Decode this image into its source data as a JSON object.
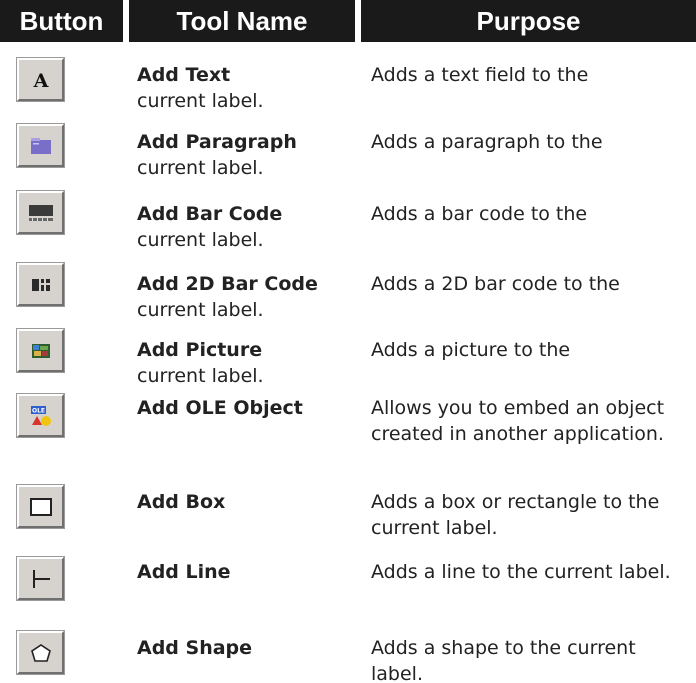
{
  "header": {
    "button": "Button",
    "tool_name": "Tool Name",
    "purpose": "Purpose"
  },
  "rows": [
    {
      "icon": "text-a-icon",
      "tool": "Add Text",
      "purpose": "Adds a text field to the",
      "continuation": "current label."
    },
    {
      "icon": "paragraph-icon",
      "tool": "Add Paragraph",
      "purpose": "Adds a paragraph to the",
      "continuation": "current label."
    },
    {
      "icon": "barcode-icon",
      "tool": "Add Bar Code",
      "purpose": "Adds a bar code to the",
      "continuation": "current label."
    },
    {
      "icon": "2d-barcode-icon",
      "tool": "Add 2D Bar Code",
      "purpose": "Adds a 2D bar code to the",
      "continuation": "current label."
    },
    {
      "icon": "picture-icon",
      "tool": "Add Picture",
      "purpose": "Adds a picture to the",
      "continuation": "current label."
    },
    {
      "icon": "ole-object-icon",
      "tool": "Add OLE Object",
      "purpose": "Allows you to embed an object created in another application."
    },
    {
      "icon": "box-icon",
      "tool": "Add Box",
      "purpose": "Adds a box or rectangle to the current label."
    },
    {
      "icon": "line-icon",
      "tool": "Add Line",
      "purpose": "Adds a line to the current label."
    },
    {
      "icon": "shape-icon",
      "tool": "Add Shape",
      "purpose": "Adds a shape to the current label."
    }
  ]
}
